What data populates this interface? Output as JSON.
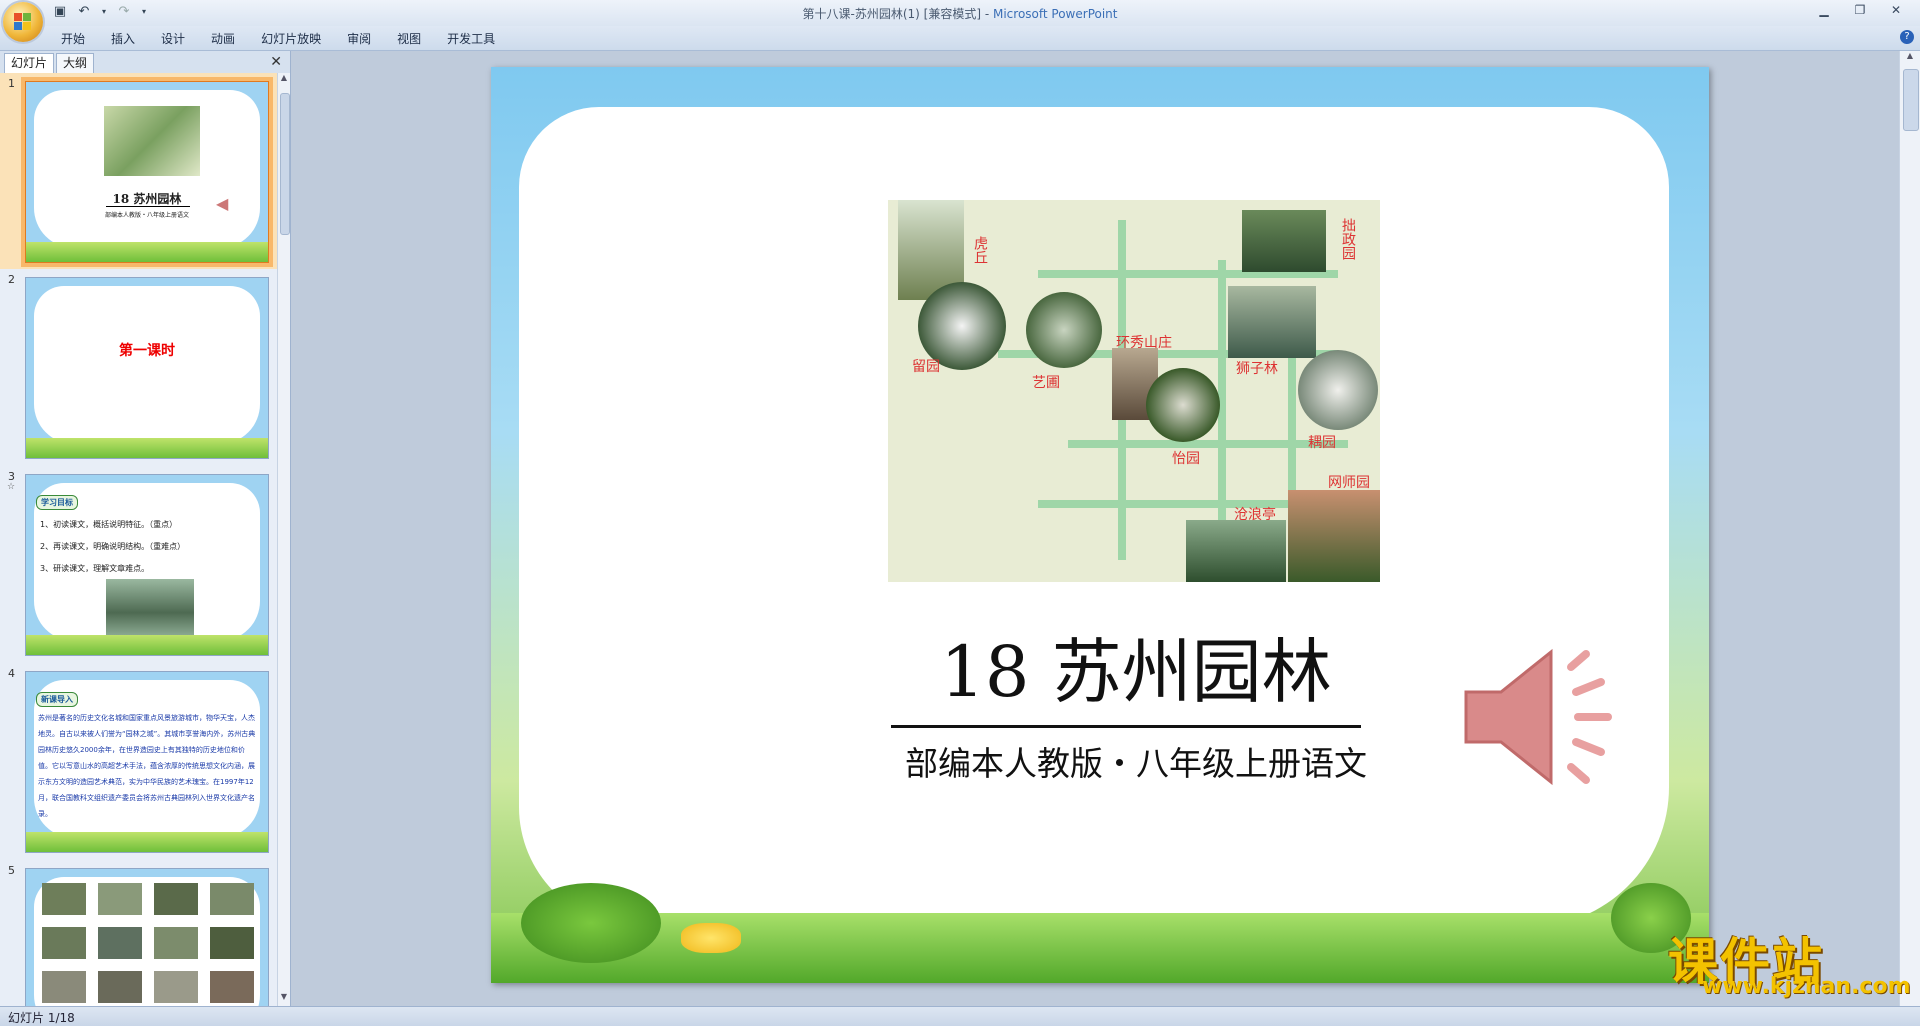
{
  "window": {
    "title": "第十八课-苏州园林(1) [兼容模式] - ",
    "app_name": "Microsoft PowerPoint"
  },
  "ribbon": {
    "tabs": [
      "开始",
      "插入",
      "设计",
      "动画",
      "幻灯片放映",
      "审阅",
      "视图",
      "开发工具"
    ]
  },
  "left_pane": {
    "tabs": [
      "幻灯片",
      "大纲"
    ],
    "close_symbol": "✕"
  },
  "thumbnails": [
    {
      "number": "1",
      "title": "18  苏州园林",
      "subtitle": "部编本人教版・八年级上册语文",
      "selected": true
    },
    {
      "number": "2",
      "text": "第一课时"
    },
    {
      "number": "3",
      "star": "☆",
      "heading": "学习目标",
      "items": [
        "1、初读课文，概括说明特征。（重点）",
        "2、再读课文，明确说明结构。（重难点）",
        "3、研读课文，理解文章难点。"
      ]
    },
    {
      "number": "4",
      "heading": "新课导入",
      "body": "苏州是著名的历史文化名城和国家重点风景旅游城市，物华天宝，人杰地灵。自古以来被人们誉为“园林之城”。其城市享誉海内外，苏州古典园林历史悠久2000余年，在世界造园史上有其独特的历史地位和价值。它以写意山水的高超艺术手法，蕴含浓厚的传统思想文化内涵，展示东方文明的造园艺术典范，实为中华民族的艺术瑰宝。在1997年12月，联合国教科文组织遗产委员会将苏州古典园林列入世界文化遗产名录。"
    },
    {
      "number": "5"
    }
  ],
  "slide": {
    "title": "18  苏州园林",
    "subtitle": "部编本人教版・八年级上册语文",
    "map_labels": {
      "huqiu": "虎丘",
      "zhuozheng": "拙政园",
      "liuyuan": "留园",
      "yipu": "艺圃",
      "huanxiu": "环秀山庄",
      "shizilin": "狮子林",
      "ouyuan": "耦园",
      "yiyuan": "怡园",
      "wangshi": "网师园",
      "canglang": "沧浪亭"
    }
  },
  "status": {
    "slide_indicator": "幻灯片 1/18"
  },
  "watermark": {
    "title": "课件站",
    "url": "www.kjzhan.com"
  },
  "colors": {
    "accent": "#3b6fb6",
    "selected_thumb": "#f8b86a",
    "map_label": "#dd3333",
    "watermark": "#f3c200"
  }
}
